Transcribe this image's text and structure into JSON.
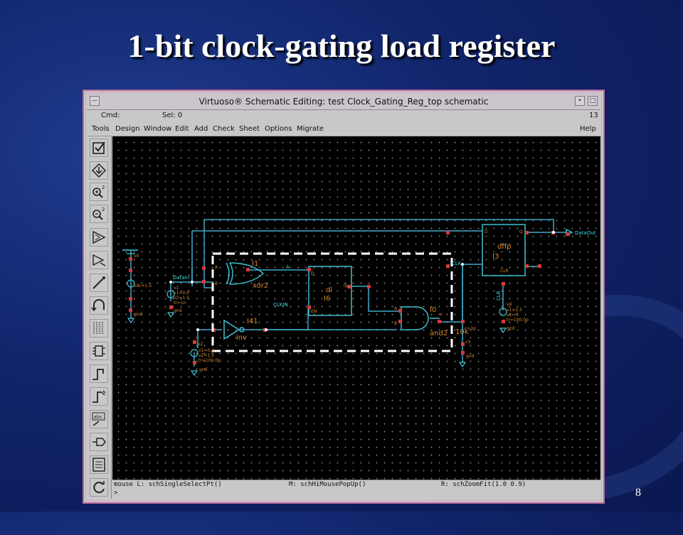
{
  "slide": {
    "title": "1-bit clock-gating load register",
    "page_number": "8"
  },
  "window": {
    "title": "Virtuoso® Schematic Editing: test Clock_Gating_Reg_top schematic",
    "cmd_label": "Cmd:",
    "sel_label": "Sel: 0",
    "window_number": "13",
    "menus": [
      "Tools",
      "Design",
      "Window",
      "Edit",
      "Add",
      "Check",
      "Sheet",
      "Options",
      "Migrate"
    ],
    "help_label": "Help",
    "mouse_left": "mouse L: schSingleSelectPt()",
    "mouse_middle": "M: schHiMousePopUp()",
    "mouse_right": "R: schZoomFit(1.0 0.9)",
    "prompt": ">"
  },
  "toolbar": {
    "icons": [
      "check-save-icon",
      "hierarchy-descend-icon",
      "zoom-in-icon",
      "zoom-out-icon",
      "instance-icon",
      "stretch-icon",
      "wire-icon",
      "undo-icon",
      "bus-icon",
      "pin-icon",
      "wire-narrow-icon",
      "wire-wide-icon",
      "label-icon",
      "property-icon",
      "note-icon",
      "redraw-icon"
    ]
  },
  "schematic": {
    "colors": {
      "wire": "#3fa9c9",
      "symbol": "#3fbfd0",
      "pin": "#d43a3a",
      "text_orange": "#d98a2b",
      "text_cyan": "#3fd9e0",
      "highlight": "#ffffff"
    },
    "labels": {
      "xor_inst": "I1",
      "xor_cell": "xor2",
      "inv_inst": "I41",
      "inv_cell": "inv",
      "dl_cell": "dl",
      "dl_inst": "I6",
      "and_inst": "I0",
      "and_cell": "and2",
      "dff_cell": "dffp",
      "dff_inst": "I3",
      "dataout": "DataOut",
      "datain": "DataIn",
      "clk": "CLK",
      "clkin": "CLKIN",
      "clr": "CLR",
      "pin_a": "A",
      "pin_b": "B",
      "pin_d": "D",
      "pin_q": "Q",
      "pin_en": "EN",
      "pin_y": "Y",
      "vdc": "vdc=1.5",
      "v0": "v0",
      "v1": "v1",
      "v2": "v2",
      "v3": "v3",
      "v4": "v4",
      "gnd": "gnd",
      "v1_params": [
        "v1=0.0",
        "v2=1.5",
        "tr=1n"
      ],
      "v2_params": [
        "v1=0.0",
        "v2=1.5",
        "tr=100.0p"
      ],
      "v4_params": [
        "v1=1.5",
        "v2=0",
        "tr=100.0p"
      ],
      "cap": "c=1p",
      "res": "10k"
    }
  }
}
